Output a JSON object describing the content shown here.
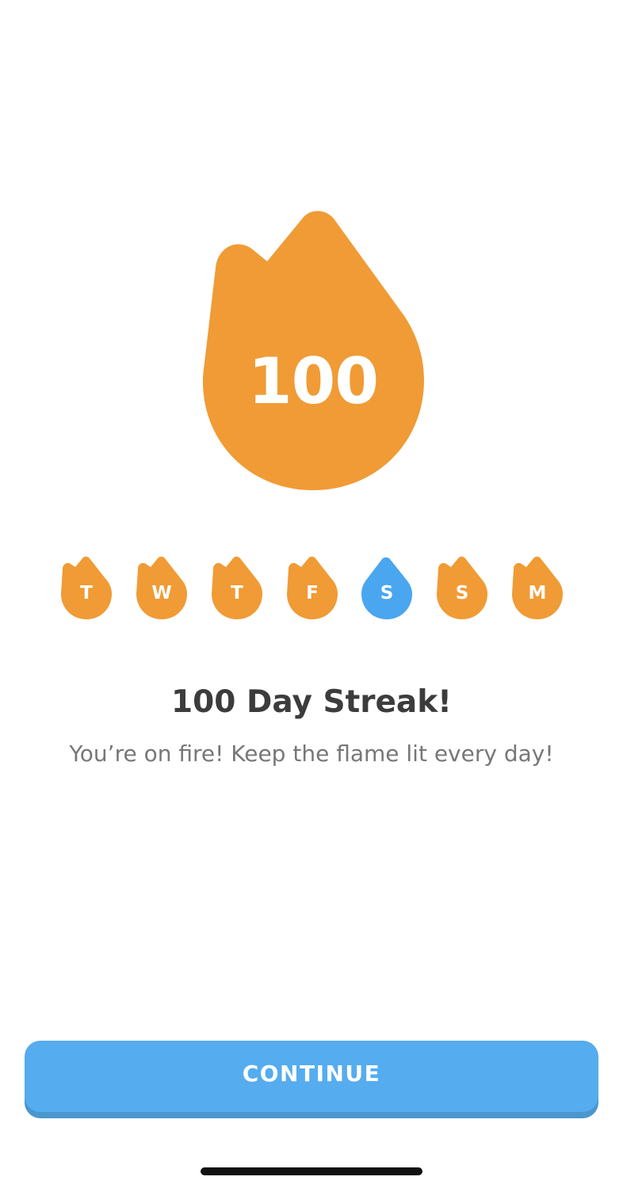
{
  "streak": {
    "count": "100",
    "flame_color": "#f09b35",
    "title": "100 Day Streak!",
    "subtitle": "You’re on fire! Keep the flame lit every day!"
  },
  "week": {
    "days": [
      {
        "letter": "T",
        "color": "#f09b35",
        "state": "completed"
      },
      {
        "letter": "W",
        "color": "#f09b35",
        "state": "completed"
      },
      {
        "letter": "T",
        "color": "#f09b35",
        "state": "completed"
      },
      {
        "letter": "F",
        "color": "#f09b35",
        "state": "completed"
      },
      {
        "letter": "S",
        "color": "#4aa6ef",
        "state": "frozen"
      },
      {
        "letter": "S",
        "color": "#f09b35",
        "state": "completed"
      },
      {
        "letter": "M",
        "color": "#f09b35",
        "state": "completed"
      }
    ]
  },
  "button": {
    "continue_label": "CONTINUE",
    "color": "#55acee"
  },
  "icons": {
    "streak": "flame-icon",
    "day": "flame-icon"
  }
}
